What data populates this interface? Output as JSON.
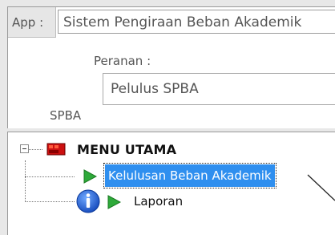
{
  "app": {
    "label": "App :",
    "selected": "Sistem Pengiraan Beban Akademik",
    "arrow_icon": "chevron-down-icon"
  },
  "role": {
    "label": "Peranan :",
    "value": "Pelulus SPBA"
  },
  "system_label": "SPBA",
  "tree": {
    "root": {
      "label": "MENU UTAMA",
      "icon": "menu-folder-icon",
      "expanded": true
    },
    "items": [
      {
        "label": "Kelulusan Beban Akademik",
        "icon": "play-icon",
        "selected": true
      },
      {
        "label": "Laporan",
        "icon": "play-icon",
        "prefix_icon": "info-icon",
        "selected": false
      }
    ]
  },
  "colors": {
    "selection": "#2f8fef",
    "play_icon": "#2eaa3a",
    "info_icon": "#1f5fd1",
    "menu_icon": "#cc1010"
  }
}
